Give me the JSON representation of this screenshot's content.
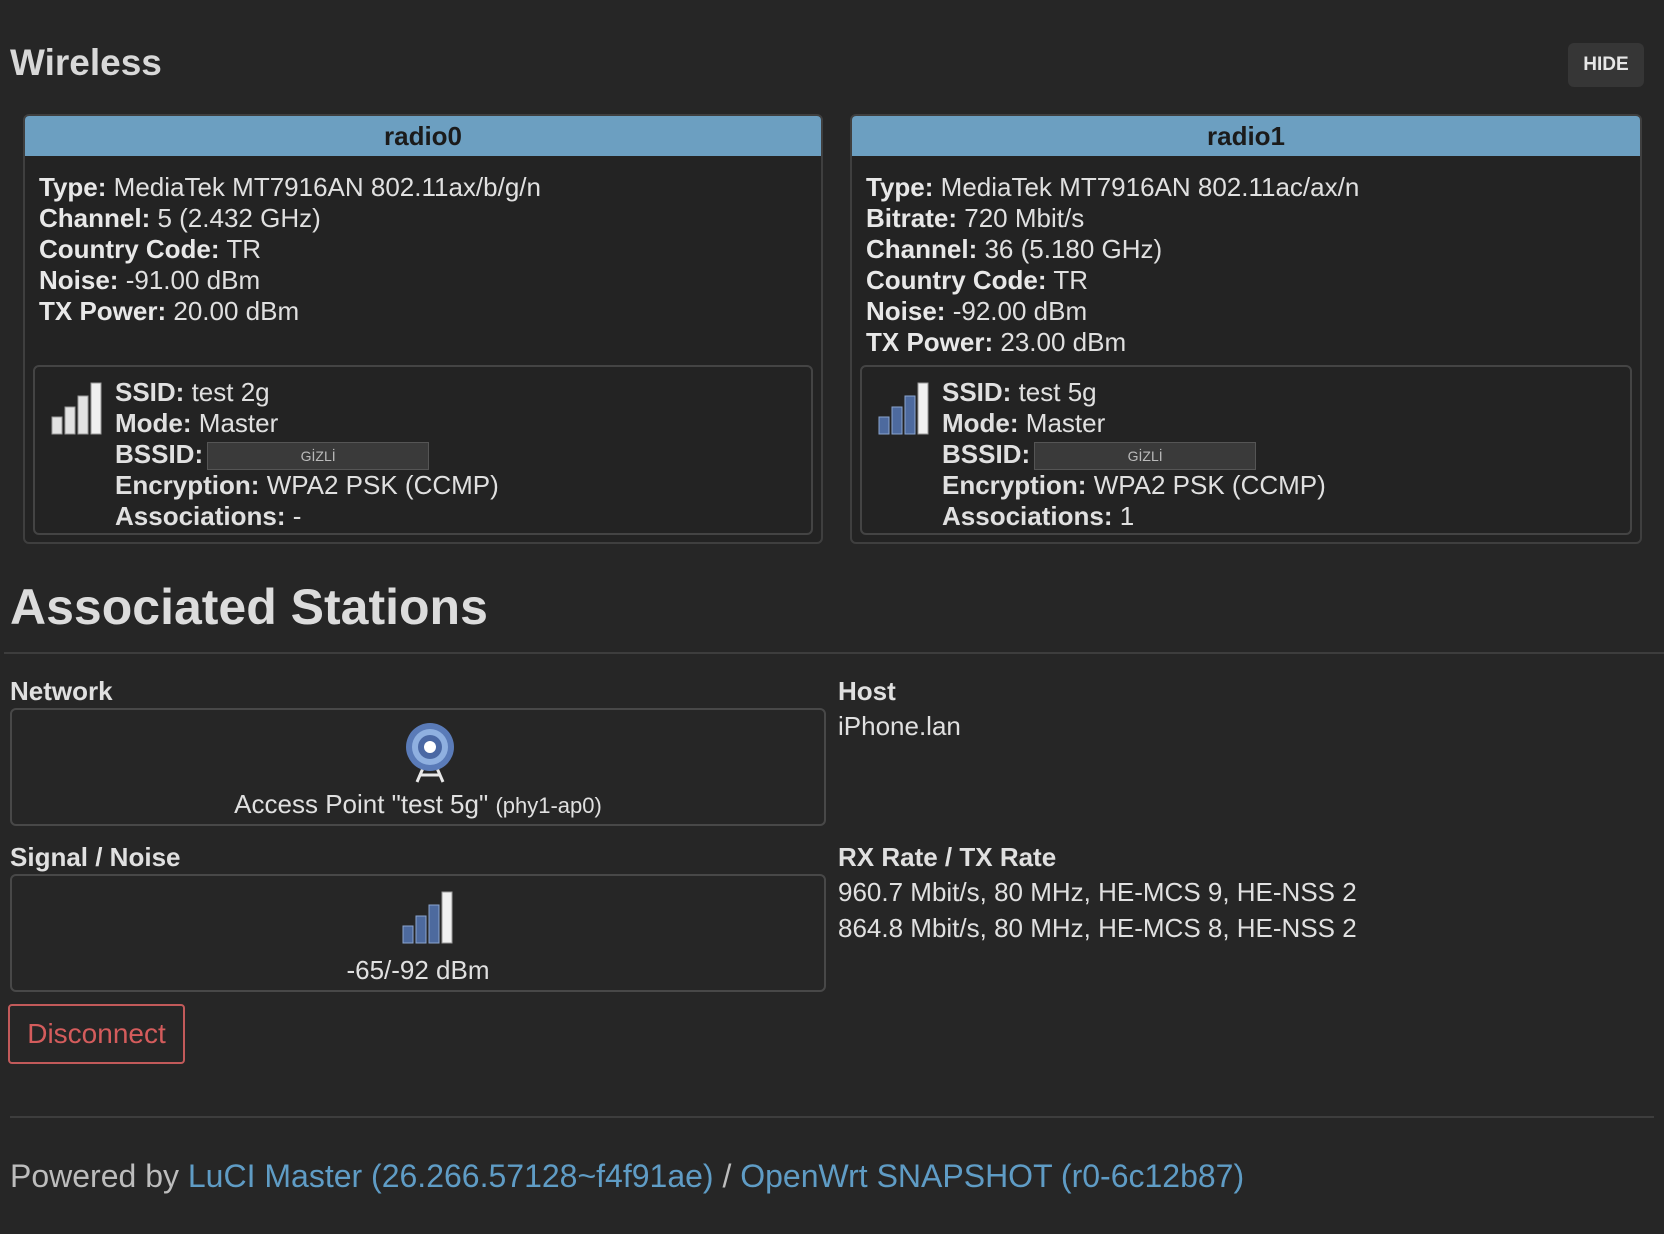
{
  "wireless": {
    "title": "Wireless",
    "hide_label": "HIDE",
    "radios": [
      {
        "name": "radio0",
        "info": [
          {
            "label": "Type:",
            "value": "MediaTek MT7916AN 802.11ax/b/g/n"
          },
          {
            "label": "Channel:",
            "value": "5 (2.432 GHz)"
          },
          {
            "label": "Country Code:",
            "value": "TR"
          },
          {
            "label": "Noise:",
            "value": "-91.00 dBm"
          },
          {
            "label": "TX Power:",
            "value": "20.00 dBm"
          }
        ],
        "iface": {
          "signal_icon": "signal-bars-inactive-icon",
          "ssid_label": "SSID:",
          "ssid": "test 2g",
          "mode_label": "Mode:",
          "mode": "Master",
          "bssid_label": "BSSID:",
          "bssid": "GİZLİ",
          "encryption_label": "Encryption:",
          "encryption": "WPA2 PSK (CCMP)",
          "associations_label": "Associations:",
          "associations": "-"
        }
      },
      {
        "name": "radio1",
        "info": [
          {
            "label": "Type:",
            "value": "MediaTek MT7916AN 802.11ac/ax/n"
          },
          {
            "label": "Bitrate:",
            "value": "720 Mbit/s"
          },
          {
            "label": "Channel:",
            "value": "36 (5.180 GHz)"
          },
          {
            "label": "Country Code:",
            "value": "TR"
          },
          {
            "label": "Noise:",
            "value": "-92.00 dBm"
          },
          {
            "label": "TX Power:",
            "value": "23.00 dBm"
          }
        ],
        "iface": {
          "signal_icon": "signal-bars-active-icon",
          "ssid_label": "SSID:",
          "ssid": "test 5g",
          "mode_label": "Mode:",
          "mode": "Master",
          "bssid_label": "BSSID:",
          "bssid": "GİZLİ",
          "encryption_label": "Encryption:",
          "encryption": "WPA2 PSK (CCMP)",
          "associations_label": "Associations:",
          "associations": "1"
        }
      }
    ]
  },
  "stations": {
    "title": "Associated Stations",
    "network_label": "Network",
    "network_icon": "access-point-icon",
    "network_main": "Access Point \"test 5g\"",
    "network_sub": "(phy1-ap0)",
    "host_label": "Host",
    "host": "iPhone.lan",
    "signal_label": "Signal / Noise",
    "signal_icon": "signal-strength-icon",
    "signal_value": "-65/-92 dBm",
    "rate_label": "RX Rate / TX Rate",
    "rx_rate": "960.7 Mbit/s, 80 MHz, HE-MCS 9, HE-NSS 2",
    "tx_rate": "864.8 Mbit/s, 80 MHz, HE-MCS 8, HE-NSS 2",
    "disconnect_label": "Disconnect"
  },
  "footer": {
    "prefix": "Powered by",
    "luci_link": "LuCI Master (26.266.57128~f4f91ae)",
    "separator": "/",
    "openwrt_link": "OpenWrt SNAPSHOT (r0-6c12b87)"
  },
  "colors": {
    "background": "#262626",
    "radio_header": "#6c9fc1",
    "signal_active": "#4d6a9e",
    "signal_inactive": "#e2e2e2",
    "link": "#5f9cc5",
    "danger": "#c25a5a"
  }
}
